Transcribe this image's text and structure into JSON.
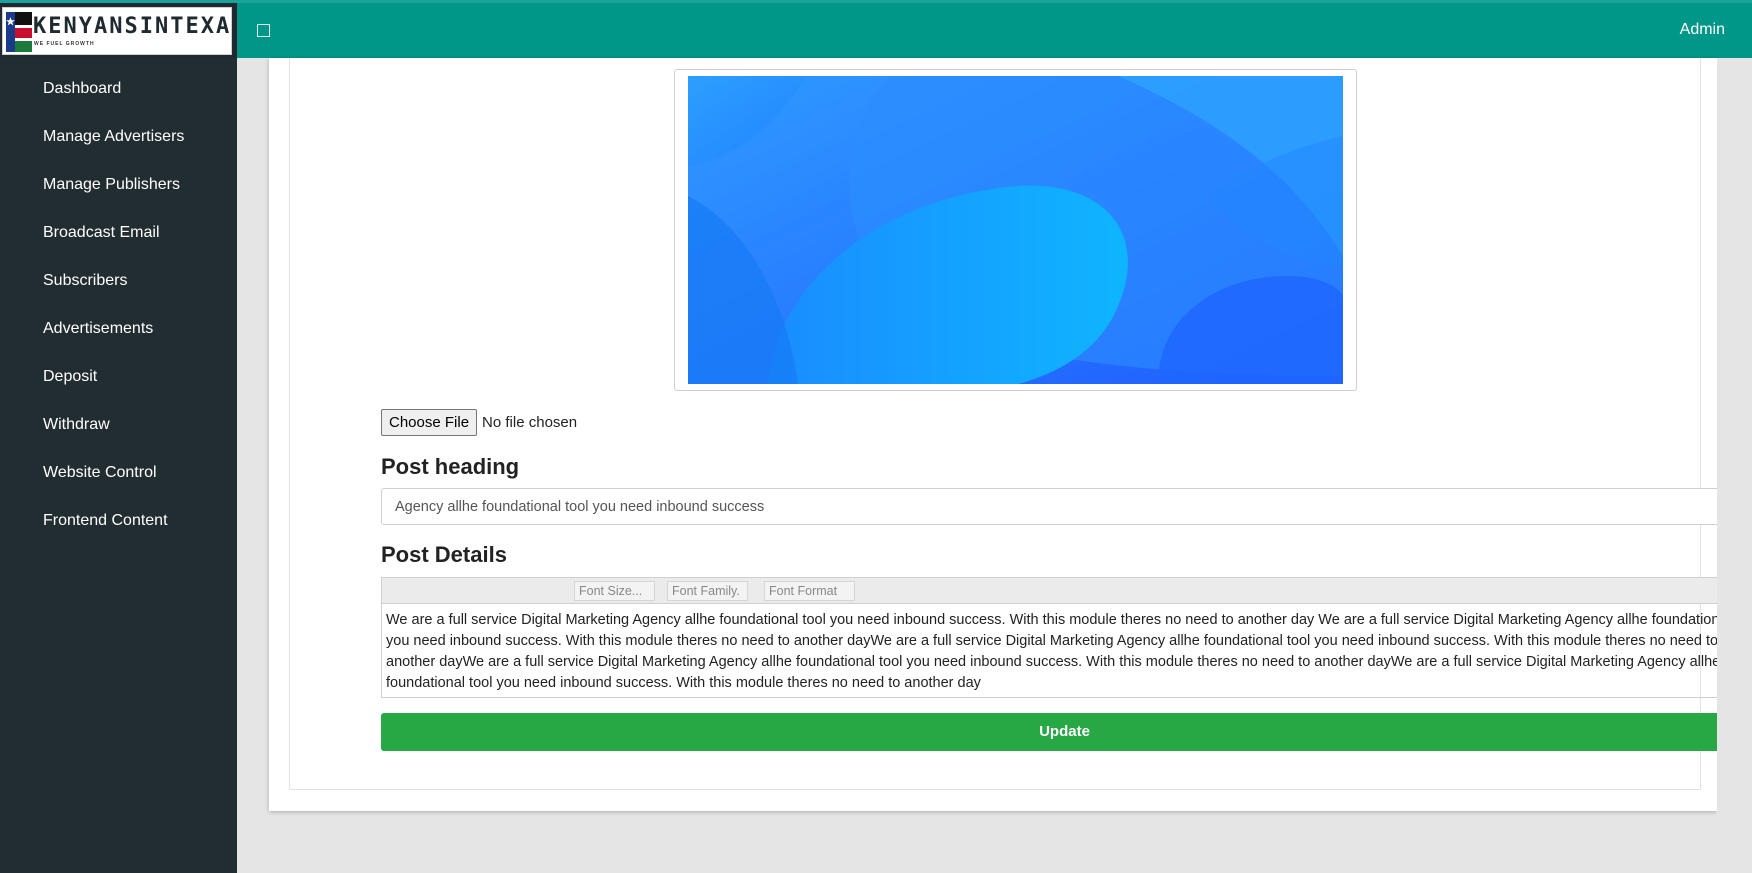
{
  "brand": {
    "name": "KENYANSINTEXAS",
    "tagline": "WE FUEL GROWTH"
  },
  "header": {
    "user_label": "Admin"
  },
  "sidebar": {
    "items": [
      {
        "label": "Dashboard"
      },
      {
        "label": "Manage Advertisers"
      },
      {
        "label": "Manage Publishers"
      },
      {
        "label": "Broadcast Email"
      },
      {
        "label": "Subscribers"
      },
      {
        "label": "Advertisements"
      },
      {
        "label": "Deposit"
      },
      {
        "label": "Withdraw"
      },
      {
        "label": "Website Control"
      },
      {
        "label": "Frontend Content"
      }
    ]
  },
  "form": {
    "file_button_label": "Choose File",
    "file_status": "No file chosen",
    "heading_label": "Post heading",
    "heading_value": "Agency allhe foundational tool you need inbound success",
    "details_label": "Post Details",
    "toolbar": {
      "font_size": "Font Size...",
      "font_family": "Font Family.",
      "font_format": "Font Format"
    },
    "details_text": "We are a full service Digital Marketing Agency allhe foundational tool you need inbound success. With this module theres no need to another day We are a full service Digital Marketing Agency allhe foundational tool you need inbound success. With this module theres no need to another dayWe are a full service Digital Marketing Agency allhe foundational tool you need inbound success. With this module theres no need to another dayWe are a full service Digital Marketing Agency allhe foundational tool you need inbound success. With this module theres no need to another dayWe are a full service Digital Marketing Agency allhe foundational tool you need inbound success. With this module theres no need to another day",
    "submit_label": "Update"
  },
  "colors": {
    "header": "#009688",
    "sidebar": "#222d32",
    "update_button": "#28a745"
  },
  "icons": {
    "menu_toggle": "menu-toggle-icon",
    "preview": "blue-abstract-image"
  }
}
